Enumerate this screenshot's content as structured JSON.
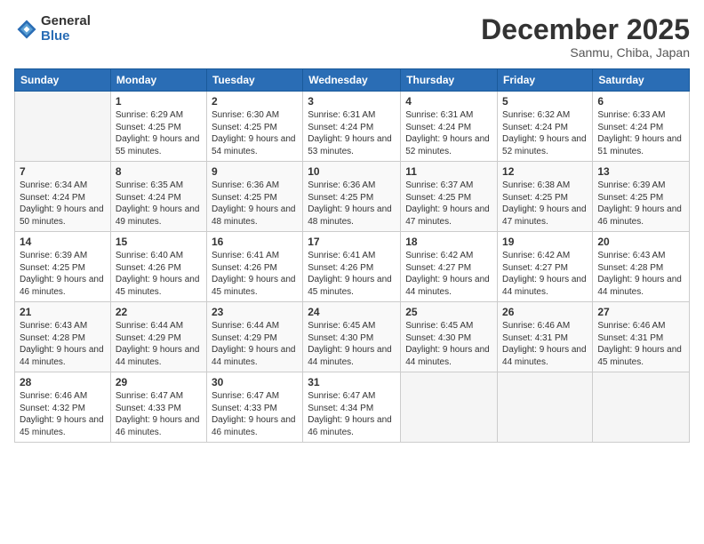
{
  "logo": {
    "general": "General",
    "blue": "Blue"
  },
  "title": "December 2025",
  "subtitle": "Sanmu, Chiba, Japan",
  "days_of_week": [
    "Sunday",
    "Monday",
    "Tuesday",
    "Wednesday",
    "Thursday",
    "Friday",
    "Saturday"
  ],
  "weeks": [
    [
      {
        "num": "",
        "sunrise": "",
        "sunset": "",
        "daylight": "",
        "empty": true
      },
      {
        "num": "1",
        "sunrise": "Sunrise: 6:29 AM",
        "sunset": "Sunset: 4:25 PM",
        "daylight": "Daylight: 9 hours and 55 minutes."
      },
      {
        "num": "2",
        "sunrise": "Sunrise: 6:30 AM",
        "sunset": "Sunset: 4:25 PM",
        "daylight": "Daylight: 9 hours and 54 minutes."
      },
      {
        "num": "3",
        "sunrise": "Sunrise: 6:31 AM",
        "sunset": "Sunset: 4:24 PM",
        "daylight": "Daylight: 9 hours and 53 minutes."
      },
      {
        "num": "4",
        "sunrise": "Sunrise: 6:31 AM",
        "sunset": "Sunset: 4:24 PM",
        "daylight": "Daylight: 9 hours and 52 minutes."
      },
      {
        "num": "5",
        "sunrise": "Sunrise: 6:32 AM",
        "sunset": "Sunset: 4:24 PM",
        "daylight": "Daylight: 9 hours and 52 minutes."
      },
      {
        "num": "6",
        "sunrise": "Sunrise: 6:33 AM",
        "sunset": "Sunset: 4:24 PM",
        "daylight": "Daylight: 9 hours and 51 minutes."
      }
    ],
    [
      {
        "num": "7",
        "sunrise": "Sunrise: 6:34 AM",
        "sunset": "Sunset: 4:24 PM",
        "daylight": "Daylight: 9 hours and 50 minutes."
      },
      {
        "num": "8",
        "sunrise": "Sunrise: 6:35 AM",
        "sunset": "Sunset: 4:24 PM",
        "daylight": "Daylight: 9 hours and 49 minutes."
      },
      {
        "num": "9",
        "sunrise": "Sunrise: 6:36 AM",
        "sunset": "Sunset: 4:25 PM",
        "daylight": "Daylight: 9 hours and 48 minutes."
      },
      {
        "num": "10",
        "sunrise": "Sunrise: 6:36 AM",
        "sunset": "Sunset: 4:25 PM",
        "daylight": "Daylight: 9 hours and 48 minutes."
      },
      {
        "num": "11",
        "sunrise": "Sunrise: 6:37 AM",
        "sunset": "Sunset: 4:25 PM",
        "daylight": "Daylight: 9 hours and 47 minutes."
      },
      {
        "num": "12",
        "sunrise": "Sunrise: 6:38 AM",
        "sunset": "Sunset: 4:25 PM",
        "daylight": "Daylight: 9 hours and 47 minutes."
      },
      {
        "num": "13",
        "sunrise": "Sunrise: 6:39 AM",
        "sunset": "Sunset: 4:25 PM",
        "daylight": "Daylight: 9 hours and 46 minutes."
      }
    ],
    [
      {
        "num": "14",
        "sunrise": "Sunrise: 6:39 AM",
        "sunset": "Sunset: 4:25 PM",
        "daylight": "Daylight: 9 hours and 46 minutes."
      },
      {
        "num": "15",
        "sunrise": "Sunrise: 6:40 AM",
        "sunset": "Sunset: 4:26 PM",
        "daylight": "Daylight: 9 hours and 45 minutes."
      },
      {
        "num": "16",
        "sunrise": "Sunrise: 6:41 AM",
        "sunset": "Sunset: 4:26 PM",
        "daylight": "Daylight: 9 hours and 45 minutes."
      },
      {
        "num": "17",
        "sunrise": "Sunrise: 6:41 AM",
        "sunset": "Sunset: 4:26 PM",
        "daylight": "Daylight: 9 hours and 45 minutes."
      },
      {
        "num": "18",
        "sunrise": "Sunrise: 6:42 AM",
        "sunset": "Sunset: 4:27 PM",
        "daylight": "Daylight: 9 hours and 44 minutes."
      },
      {
        "num": "19",
        "sunrise": "Sunrise: 6:42 AM",
        "sunset": "Sunset: 4:27 PM",
        "daylight": "Daylight: 9 hours and 44 minutes."
      },
      {
        "num": "20",
        "sunrise": "Sunrise: 6:43 AM",
        "sunset": "Sunset: 4:28 PM",
        "daylight": "Daylight: 9 hours and 44 minutes."
      }
    ],
    [
      {
        "num": "21",
        "sunrise": "Sunrise: 6:43 AM",
        "sunset": "Sunset: 4:28 PM",
        "daylight": "Daylight: 9 hours and 44 minutes."
      },
      {
        "num": "22",
        "sunrise": "Sunrise: 6:44 AM",
        "sunset": "Sunset: 4:29 PM",
        "daylight": "Daylight: 9 hours and 44 minutes."
      },
      {
        "num": "23",
        "sunrise": "Sunrise: 6:44 AM",
        "sunset": "Sunset: 4:29 PM",
        "daylight": "Daylight: 9 hours and 44 minutes."
      },
      {
        "num": "24",
        "sunrise": "Sunrise: 6:45 AM",
        "sunset": "Sunset: 4:30 PM",
        "daylight": "Daylight: 9 hours and 44 minutes."
      },
      {
        "num": "25",
        "sunrise": "Sunrise: 6:45 AM",
        "sunset": "Sunset: 4:30 PM",
        "daylight": "Daylight: 9 hours and 44 minutes."
      },
      {
        "num": "26",
        "sunrise": "Sunrise: 6:46 AM",
        "sunset": "Sunset: 4:31 PM",
        "daylight": "Daylight: 9 hours and 44 minutes."
      },
      {
        "num": "27",
        "sunrise": "Sunrise: 6:46 AM",
        "sunset": "Sunset: 4:31 PM",
        "daylight": "Daylight: 9 hours and 45 minutes."
      }
    ],
    [
      {
        "num": "28",
        "sunrise": "Sunrise: 6:46 AM",
        "sunset": "Sunset: 4:32 PM",
        "daylight": "Daylight: 9 hours and 45 minutes."
      },
      {
        "num": "29",
        "sunrise": "Sunrise: 6:47 AM",
        "sunset": "Sunset: 4:33 PM",
        "daylight": "Daylight: 9 hours and 46 minutes."
      },
      {
        "num": "30",
        "sunrise": "Sunrise: 6:47 AM",
        "sunset": "Sunset: 4:33 PM",
        "daylight": "Daylight: 9 hours and 46 minutes."
      },
      {
        "num": "31",
        "sunrise": "Sunrise: 6:47 AM",
        "sunset": "Sunset: 4:34 PM",
        "daylight": "Daylight: 9 hours and 46 minutes."
      },
      {
        "num": "",
        "sunrise": "",
        "sunset": "",
        "daylight": "",
        "empty": true
      },
      {
        "num": "",
        "sunrise": "",
        "sunset": "",
        "daylight": "",
        "empty": true
      },
      {
        "num": "",
        "sunrise": "",
        "sunset": "",
        "daylight": "",
        "empty": true
      }
    ]
  ]
}
